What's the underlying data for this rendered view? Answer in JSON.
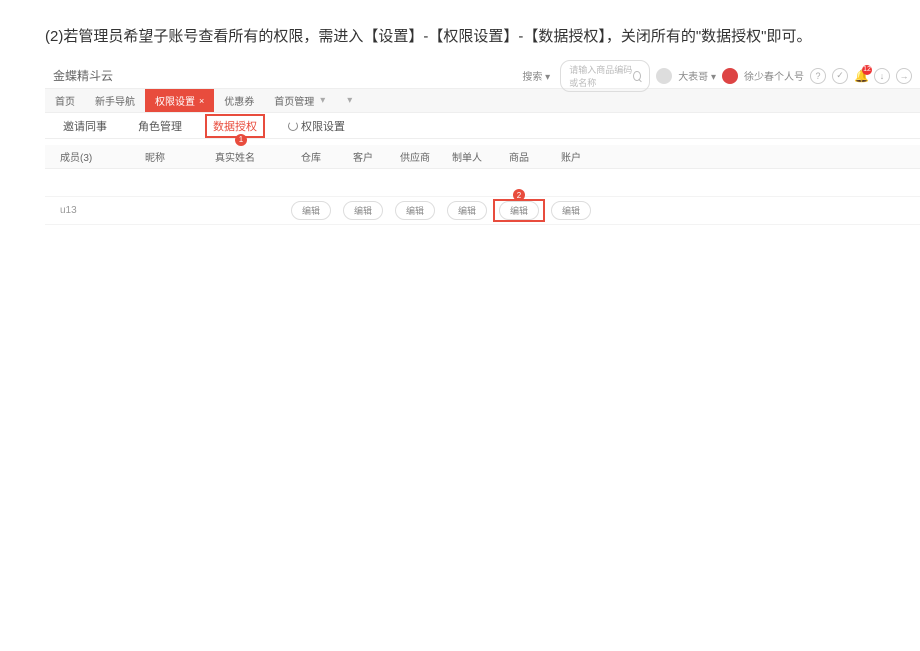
{
  "instruction": "(2)若管理员希望子账号查看所有的权限，需进入【设置】-【权限设置】-【数据授权】，关闭所有的\"数据授权\"即可。",
  "app_title": "金蝶精斗云",
  "header": {
    "dropdown": "搜索 ▾",
    "search_placeholder": "请输入商品编码或名称",
    "user1": "大表哥 ▾",
    "user2": "徐少春个人号",
    "help": "?",
    "check": "✓",
    "bell_badge": "12",
    "arrow1": "↓",
    "arrow2": "→"
  },
  "tabs": [
    "首页",
    "新手导航",
    "权限设置",
    "优惠券",
    "首页管理"
  ],
  "tab_close": "×",
  "sub_tabs": {
    "invite": "邀请同事",
    "role": "角色管理",
    "data_auth": "数据授权",
    "perm": "权限设置"
  },
  "badge1": "1",
  "badge2": "2",
  "table_headers": {
    "id": "成员(3)",
    "alias": "昵称",
    "name": "真实姓名",
    "c1": "仓库",
    "c2": "客户",
    "c3": "供应商",
    "c4": "制单人",
    "c5": "商品",
    "c6": "账户"
  },
  "rows": [
    {
      "id": "",
      "alias": "",
      "name": "",
      "buttons": [
        "",
        "",
        "",
        "",
        "",
        ""
      ]
    },
    {
      "id": "u13",
      "alias": "",
      "name": "",
      "buttons": [
        "编辑",
        "编辑",
        "编辑",
        "编辑",
        "编辑",
        "编辑"
      ]
    }
  ],
  "btn_label": "编辑"
}
